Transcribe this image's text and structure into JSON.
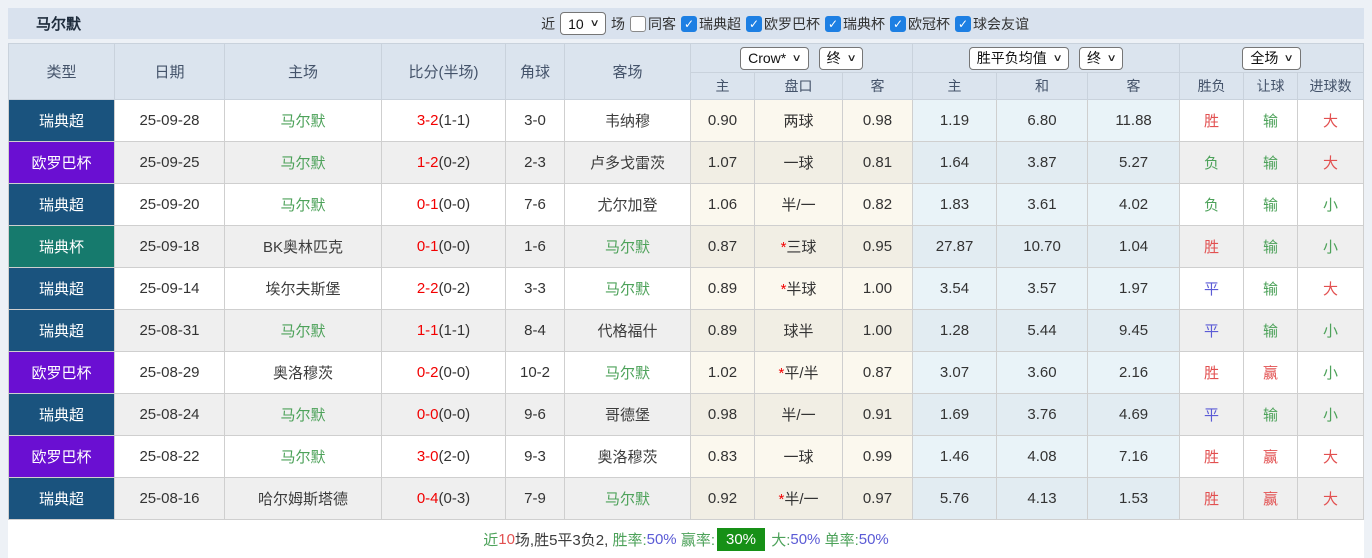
{
  "toolbar": {
    "title": "马尔默",
    "recent_label": "近",
    "recent_value": "10",
    "matches_label": "场",
    "filters": [
      {
        "label": "同客",
        "checked": false
      },
      {
        "label": "瑞典超",
        "checked": true
      },
      {
        "label": "欧罗巴杯",
        "checked": true
      },
      {
        "label": "瑞典杯",
        "checked": true
      },
      {
        "label": "欧冠杯",
        "checked": true
      },
      {
        "label": "球会友谊",
        "checked": true
      }
    ]
  },
  "table": {
    "headers": {
      "type": "类型",
      "date": "日期",
      "home": "主场",
      "score": "比分(半场)",
      "corner": "角球",
      "away": "客场",
      "sub": {
        "h_home": "主",
        "h_handicap": "盘口",
        "h_away": "客",
        "e_home": "主",
        "e_draw": "和",
        "e_away": "客",
        "result": "胜负",
        "give": "让球",
        "goals": "进球数"
      },
      "selects": {
        "company": "Crow*",
        "company_time": "终",
        "europe": "胜平负均值",
        "europe_time": "终",
        "scope": "全场"
      }
    },
    "rows": [
      {
        "league": "瑞典超",
        "league_color": "swe-super",
        "date": "25-09-28",
        "home": "马尔默",
        "home_color": "green",
        "score": "3-2",
        "half": "(1-1)",
        "corner": "3-0",
        "away": "韦纳穆",
        "away_color": "dark",
        "odds_home": "0.90",
        "star": "",
        "handicap": "两球",
        "odds_away": "0.98",
        "avg_home": "1.19",
        "avg_draw": "6.80",
        "avg_away": "11.88",
        "result": "胜",
        "result_color": "red",
        "give": "输",
        "give_color": "green",
        "goals": "大",
        "goals_color": "red"
      },
      {
        "league": "欧罗巴杯",
        "league_color": "europa",
        "date": "25-09-25",
        "home": "马尔默",
        "home_color": "green",
        "score": "1-2",
        "half": "(0-2)",
        "corner": "2-3",
        "away": "卢多戈雷茨",
        "away_color": "dark",
        "odds_home": "1.07",
        "star": "",
        "handicap": "一球",
        "odds_away": "0.81",
        "avg_home": "1.64",
        "avg_draw": "3.87",
        "avg_away": "5.27",
        "result": "负",
        "result_color": "green",
        "give": "输",
        "give_color": "green",
        "goals": "大",
        "goals_color": "red"
      },
      {
        "league": "瑞典超",
        "league_color": "swe-super",
        "date": "25-09-20",
        "home": "马尔默",
        "home_color": "green",
        "score": "0-1",
        "half": "(0-0)",
        "corner": "7-6",
        "away": "尤尔加登",
        "away_color": "dark",
        "odds_home": "1.06",
        "star": "",
        "handicap": "半/一",
        "odds_away": "0.82",
        "avg_home": "1.83",
        "avg_draw": "3.61",
        "avg_away": "4.02",
        "result": "负",
        "result_color": "green",
        "give": "输",
        "give_color": "green",
        "goals": "小",
        "goals_color": "green"
      },
      {
        "league": "瑞典杯",
        "league_color": "swe-cup",
        "date": "25-09-18",
        "home": "BK奥林匹克",
        "home_color": "dark",
        "score": "0-1",
        "half": "(0-0)",
        "corner": "1-6",
        "away": "马尔默",
        "away_color": "green",
        "odds_home": "0.87",
        "star": "*",
        "handicap": "三球",
        "odds_away": "0.95",
        "avg_home": "27.87",
        "avg_draw": "10.70",
        "avg_away": "1.04",
        "result": "胜",
        "result_color": "red",
        "give": "输",
        "give_color": "green",
        "goals": "小",
        "goals_color": "green"
      },
      {
        "league": "瑞典超",
        "league_color": "swe-super",
        "date": "25-09-14",
        "home": "埃尔夫斯堡",
        "home_color": "dark",
        "score": "2-2",
        "half": "(0-2)",
        "corner": "3-3",
        "away": "马尔默",
        "away_color": "green",
        "odds_home": "0.89",
        "star": "*",
        "handicap": "半球",
        "odds_away": "1.00",
        "avg_home": "3.54",
        "avg_draw": "3.57",
        "avg_away": "1.97",
        "result": "平",
        "result_color": "blue",
        "give": "输",
        "give_color": "green",
        "goals": "大",
        "goals_color": "red"
      },
      {
        "league": "瑞典超",
        "league_color": "swe-super",
        "date": "25-08-31",
        "home": "马尔默",
        "home_color": "green",
        "score": "1-1",
        "half": "(1-1)",
        "corner": "8-4",
        "away": "代格福什",
        "away_color": "dark",
        "odds_home": "0.89",
        "star": "",
        "handicap": "球半",
        "odds_away": "1.00",
        "avg_home": "1.28",
        "avg_draw": "5.44",
        "avg_away": "9.45",
        "result": "平",
        "result_color": "blue",
        "give": "输",
        "give_color": "green",
        "goals": "小",
        "goals_color": "green"
      },
      {
        "league": "欧罗巴杯",
        "league_color": "europa",
        "date": "25-08-29",
        "home": "奥洛穆茨",
        "home_color": "dark",
        "score": "0-2",
        "half": "(0-0)",
        "corner": "10-2",
        "away": "马尔默",
        "away_color": "green",
        "odds_home": "1.02",
        "star": "*",
        "handicap": "平/半",
        "odds_away": "0.87",
        "avg_home": "3.07",
        "avg_draw": "3.60",
        "avg_away": "2.16",
        "result": "胜",
        "result_color": "red",
        "give": "赢",
        "give_color": "red",
        "goals": "小",
        "goals_color": "green"
      },
      {
        "league": "瑞典超",
        "league_color": "swe-super",
        "date": "25-08-24",
        "home": "马尔默",
        "home_color": "green",
        "score": "0-0",
        "half": "(0-0)",
        "corner": "9-6",
        "away": "哥德堡",
        "away_color": "dark",
        "odds_home": "0.98",
        "star": "",
        "handicap": "半/一",
        "odds_away": "0.91",
        "avg_home": "1.69",
        "avg_draw": "3.76",
        "avg_away": "4.69",
        "result": "平",
        "result_color": "blue",
        "give": "输",
        "give_color": "green",
        "goals": "小",
        "goals_color": "green"
      },
      {
        "league": "欧罗巴杯",
        "league_color": "europa",
        "date": "25-08-22",
        "home": "马尔默",
        "home_color": "green",
        "score": "3-0",
        "half": "(2-0)",
        "corner": "9-3",
        "away": "奥洛穆茨",
        "away_color": "dark",
        "odds_home": "0.83",
        "star": "",
        "handicap": "一球",
        "odds_away": "0.99",
        "avg_home": "1.46",
        "avg_draw": "4.08",
        "avg_away": "7.16",
        "result": "胜",
        "result_color": "red",
        "give": "赢",
        "give_color": "red",
        "goals": "大",
        "goals_color": "red"
      },
      {
        "league": "瑞典超",
        "league_color": "swe-super",
        "date": "25-08-16",
        "home": "哈尔姆斯塔德",
        "home_color": "dark",
        "score": "0-4",
        "half": "(0-3)",
        "corner": "7-9",
        "away": "马尔默",
        "away_color": "green",
        "odds_home": "0.92",
        "star": "*",
        "handicap": "半/一",
        "odds_away": "0.97",
        "avg_home": "5.76",
        "avg_draw": "4.13",
        "avg_away": "1.53",
        "result": "胜",
        "result_color": "red",
        "give": "赢",
        "give_color": "red",
        "goals": "大",
        "goals_color": "red"
      }
    ]
  },
  "footer": {
    "segments": [
      {
        "text": "近",
        "color": "green"
      },
      {
        "text": "10",
        "color": "red"
      },
      {
        "text": "场,胜5平3负2, ",
        "color": "dark"
      },
      {
        "text": "胜率:",
        "color": "green"
      },
      {
        "text": "50%",
        "color": "blue"
      },
      {
        "text": " 赢率:",
        "color": "green"
      },
      {
        "text": "30%",
        "color": "white-on-green"
      },
      {
        "text": " 大:",
        "color": "green"
      },
      {
        "text": "50%",
        "color": "blue"
      },
      {
        "text": " 单率:",
        "color": "green"
      },
      {
        "text": "50%",
        "color": "blue"
      }
    ]
  },
  "colors": {
    "league_swe_super": "#1a537e",
    "league_europa": "#6a0fd2",
    "league_swe_cup": "#167a6d",
    "team_green": "#4da25a",
    "score_red": "#f20000",
    "result_red": "#e25050",
    "result_blue": "#5b5bd6",
    "footer_blue": "#5b5bd6",
    "win_rate_badge_bg": "#169016",
    "checkbox_blue": "#1d7fe3",
    "header_bg": "#dbe4ee"
  }
}
